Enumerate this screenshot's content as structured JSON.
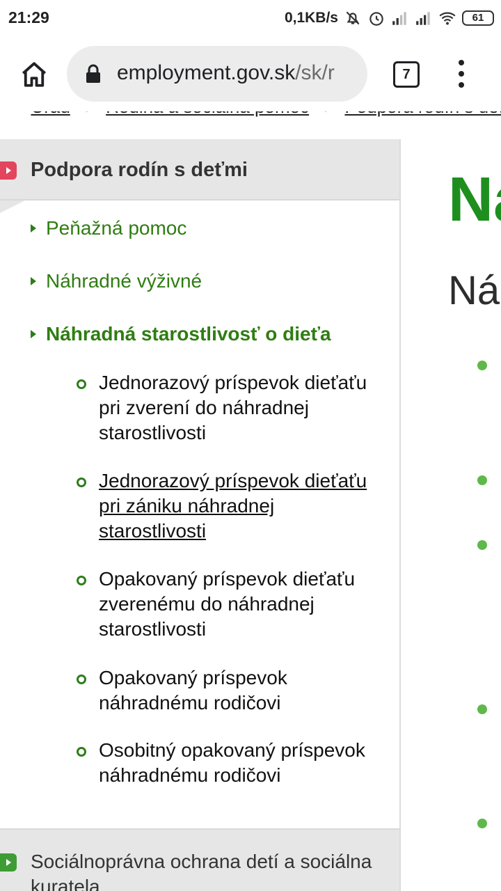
{
  "status_bar": {
    "time": "21:29",
    "network_speed": "0,1KB/s",
    "battery_level": "61",
    "icons": [
      "bell-off-icon",
      "alarm-icon",
      "signal-icon",
      "signal-icon",
      "wifi-icon",
      "battery-icon"
    ]
  },
  "browser": {
    "url_host": "employment.gov.sk",
    "url_path": "/sk/r",
    "tab_count": "7",
    "icons": [
      "home-icon",
      "lock-icon",
      "tabs-icon",
      "more-vert-icon"
    ]
  },
  "breadcrumb": {
    "items": [
      "Úrad",
      "Rodina a sociálna pomoc",
      "Podpora rodín s deťmi"
    ]
  },
  "sidebar": {
    "header_title": "Podpora rodín s deťmi",
    "items": [
      {
        "label": "Peňažná pomoc"
      },
      {
        "label": "Náhradné výživné"
      },
      {
        "label": "Náhradná starostlivosť o dieťa"
      }
    ],
    "sub_items": [
      {
        "label": "Jednorazový príspevok dieťaťu pri zverení do náhradnej starostlivosti"
      },
      {
        "label": "Jednorazový príspevok dieťaťu pri zániku náhradnej starostlivosti"
      },
      {
        "label": "Opakovaný príspevok dieťaťu zverenému do náhradnej starostlivosti"
      },
      {
        "label": "Opakovaný príspevok náhradnému rodičovi"
      },
      {
        "label": "Osobitný opakovaný príspevok náhradnému rodičovi"
      }
    ],
    "footer_title": "Sociálnoprávna ochrana detí a sociálna kuratela"
  },
  "main": {
    "title": "Na",
    "subtitle": "Ná"
  },
  "colors": {
    "accent_green": "#2f7d12",
    "title_green": "#1e8f1e",
    "header_red": "#e2455c",
    "sidebar_gray": "#e6e6e6"
  }
}
